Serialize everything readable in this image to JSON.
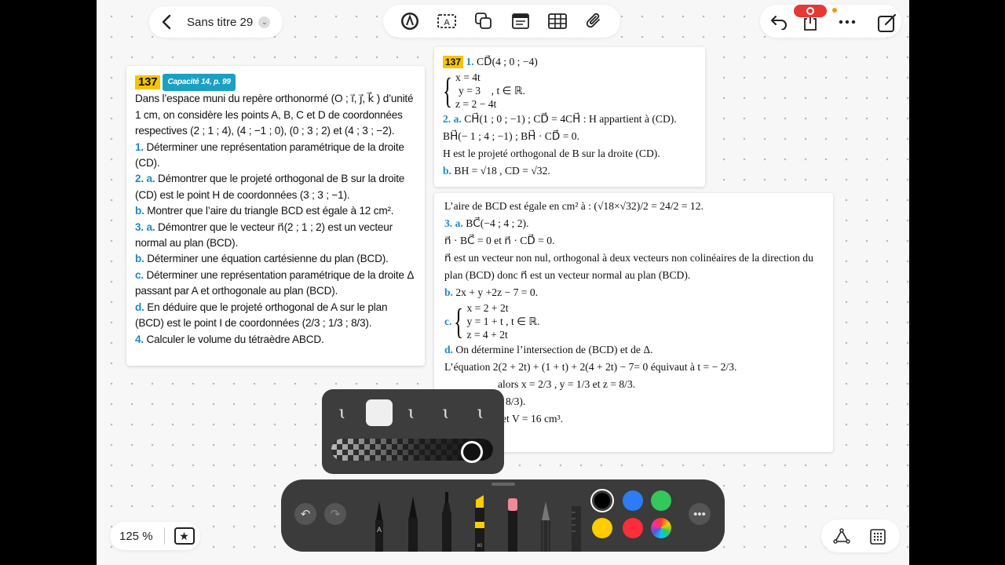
{
  "header": {
    "title": "Sans titre 29"
  },
  "zoom": {
    "label": "125 %"
  },
  "exercise": {
    "number": "137",
    "capacity": "Capacité 14, p. 99",
    "paragraphs": [
      "Dans l’espace muni du repère orthonormé (O ; i⃗, j⃗, k⃗ ) d’unité 1 cm, on considère les points A, B, C et D de coordonnées respectives (2 ; 1 ; 4), (4 ; −1 ; 0), (0 ; 3 ; 2) et (4 ; 3 ; −2)."
    ],
    "questions": [
      {
        "label": "1.",
        "text": "Déterminer une représentation paramétrique de la droite (CD)."
      },
      {
        "label": "2. a.",
        "text": "Démontrer que le projeté orthogonal de B sur la droite (CD) est le point H de coordonnées (3 ; 3 ; −1)."
      },
      {
        "label": "b.",
        "text": "Montrer que l’aire du triangle BCD est égale à 12 cm²."
      },
      {
        "label": "3. a.",
        "text": "Démontrer que le vecteur n⃗(2 ; 1 ; 2) est un vecteur normal au plan (BCD)."
      },
      {
        "label": "b.",
        "text": "Déterminer une équation cartésienne du plan (BCD)."
      },
      {
        "label": "c.",
        "text": "Déterminer une représentation paramétrique de la droite Δ passant par A et orthogonale au plan (BCD)."
      },
      {
        "label": "d.",
        "text": "En déduire que le projeté orthogonal de A sur le plan (BCD) est le point I de coordonnées (2/3 ; 1/3 ; 8/3)."
      },
      {
        "label": "4.",
        "text": "Calculer le volume du tétraèdre ABCD."
      }
    ]
  },
  "solution1": {
    "number": "137",
    "l1_label": "1.",
    "l1": "CD⃗(4 ; 0 ; −4)",
    "sys1": [
      "x = 4t",
      "y = 3",
      "z = 2 − 4t"
    ],
    "sys1_tail": ", t ∈ ℝ.",
    "l2_label": "2. a.",
    "l2": "CH⃗(1 ; 0 ; −1) ; CD⃗ = 4CH⃗ : H appartient à (CD).",
    "l3": "BH⃗(− 1 ; 4 ; −1) ; BH⃗ · CD⃗ = 0.",
    "l4": "H est le projeté orthogonal de B sur la droite (CD).",
    "l5_label": "b.",
    "l5": "BH = √18 , CD = √32."
  },
  "solution2": {
    "l1": "L’aire de BCD est égale en cm² à : (√18×√32)/2 = 24/2 = 12.",
    "l2_label": "3. a.",
    "l2": "BC⃗(−4 ; 4 ; 2).",
    "l3": "n⃗ · BC⃗ = 0 et n⃗ · CD⃗ = 0.",
    "l4": "n⃗ est un vecteur non nul, orthogonal à deux vecteurs non colinéaires de la direction du",
    "l5": "plan (BCD) donc n⃗ est un vecteur normal au plan (BCD).",
    "l6_label": "b.",
    "l6": "2x + y +2z − 7 = 0.",
    "l7_label": "c.",
    "sys": [
      "x = 2 + 2t",
      "y = 1 + t",
      "z = 4 + 2t"
    ],
    "sys_tail": ", t ∈ ℝ.",
    "l8_label": "d.",
    "l8": "On détermine l’intersection de (BCD) et de Δ.",
    "l9": "L’équation 2(2 + 2t) + (1 + t) + 2(4 + 2t) − 7= 0 équivaut à t = − 2/3.",
    "l10": "alors x = 2/3 , y = 1/3 et z = 8/3.",
    "l11": "8/3).",
    "l12": "et V = 16 cm³."
  },
  "colors": {
    "accent_yellow": "#f7c500",
    "accent_blue": "#1e88c8",
    "record_red": "#e53935",
    "swatches": [
      "#000000",
      "#2d7cf6",
      "#34c759",
      "#ffcc00",
      "#ff2d3a",
      "rainbow"
    ]
  },
  "icons": [
    "back-chevron-icon",
    "pen-circle-icon",
    "text-box-icon",
    "shapes-icon",
    "note-icon",
    "table-icon",
    "paperclip-icon",
    "undo-icon",
    "share-icon",
    "more-icon",
    "new-note-icon",
    "lasso-icon",
    "grid-icon",
    "star-icon"
  ]
}
